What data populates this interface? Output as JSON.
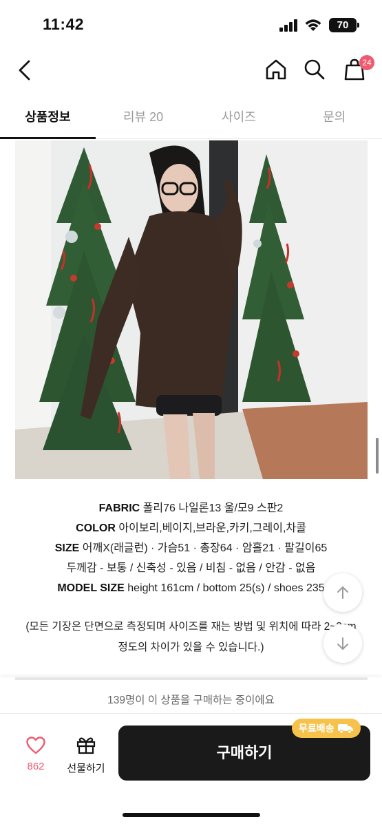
{
  "status": {
    "time": "11:42",
    "battery": "70"
  },
  "header": {
    "cart_count": "24"
  },
  "tabs": [
    {
      "label": "상품정보"
    },
    {
      "label": "리뷰 20"
    },
    {
      "label": "사이즈"
    },
    {
      "label": "문의"
    }
  ],
  "specs": {
    "fabric_label": "FABRIC",
    "fabric_value": "폴리76 나일론13 울/모9 스판2",
    "color_label": "COLOR",
    "color_value": "아이보리,베이지,브라운,카키,그레이,차콜",
    "size_label": "SIZE",
    "size_value": "어깨X(래글런) · 가슴51 · 총장64 · 암홀21 · 팔길이65",
    "feel_line": "두께감 - 보통 / 신축성 - 있음 / 비침 - 없음 / 안감 - 없음",
    "model_label": "MODEL SIZE",
    "model_value": "height 161cm / bottom 25(s) / shoes 235",
    "note_line1": "(모든 기장은 단면으로 측정되며 사이즈를 재는 방법 및 위치에 따라 2~3cm",
    "note_line2": "정도의 차이가 있을 수 있습니다.)"
  },
  "bottom": {
    "buying_now": "139명이 이 상품을 구매하는 중이에요",
    "like_count": "862",
    "gift_label": "선물하기",
    "buy_label": "구매하기",
    "free_shipping": "무료배송"
  },
  "colors": {
    "accent": "#ef5a6f",
    "buy_button": "#1a1a1a",
    "badge_yellow": "#f6c24c"
  }
}
